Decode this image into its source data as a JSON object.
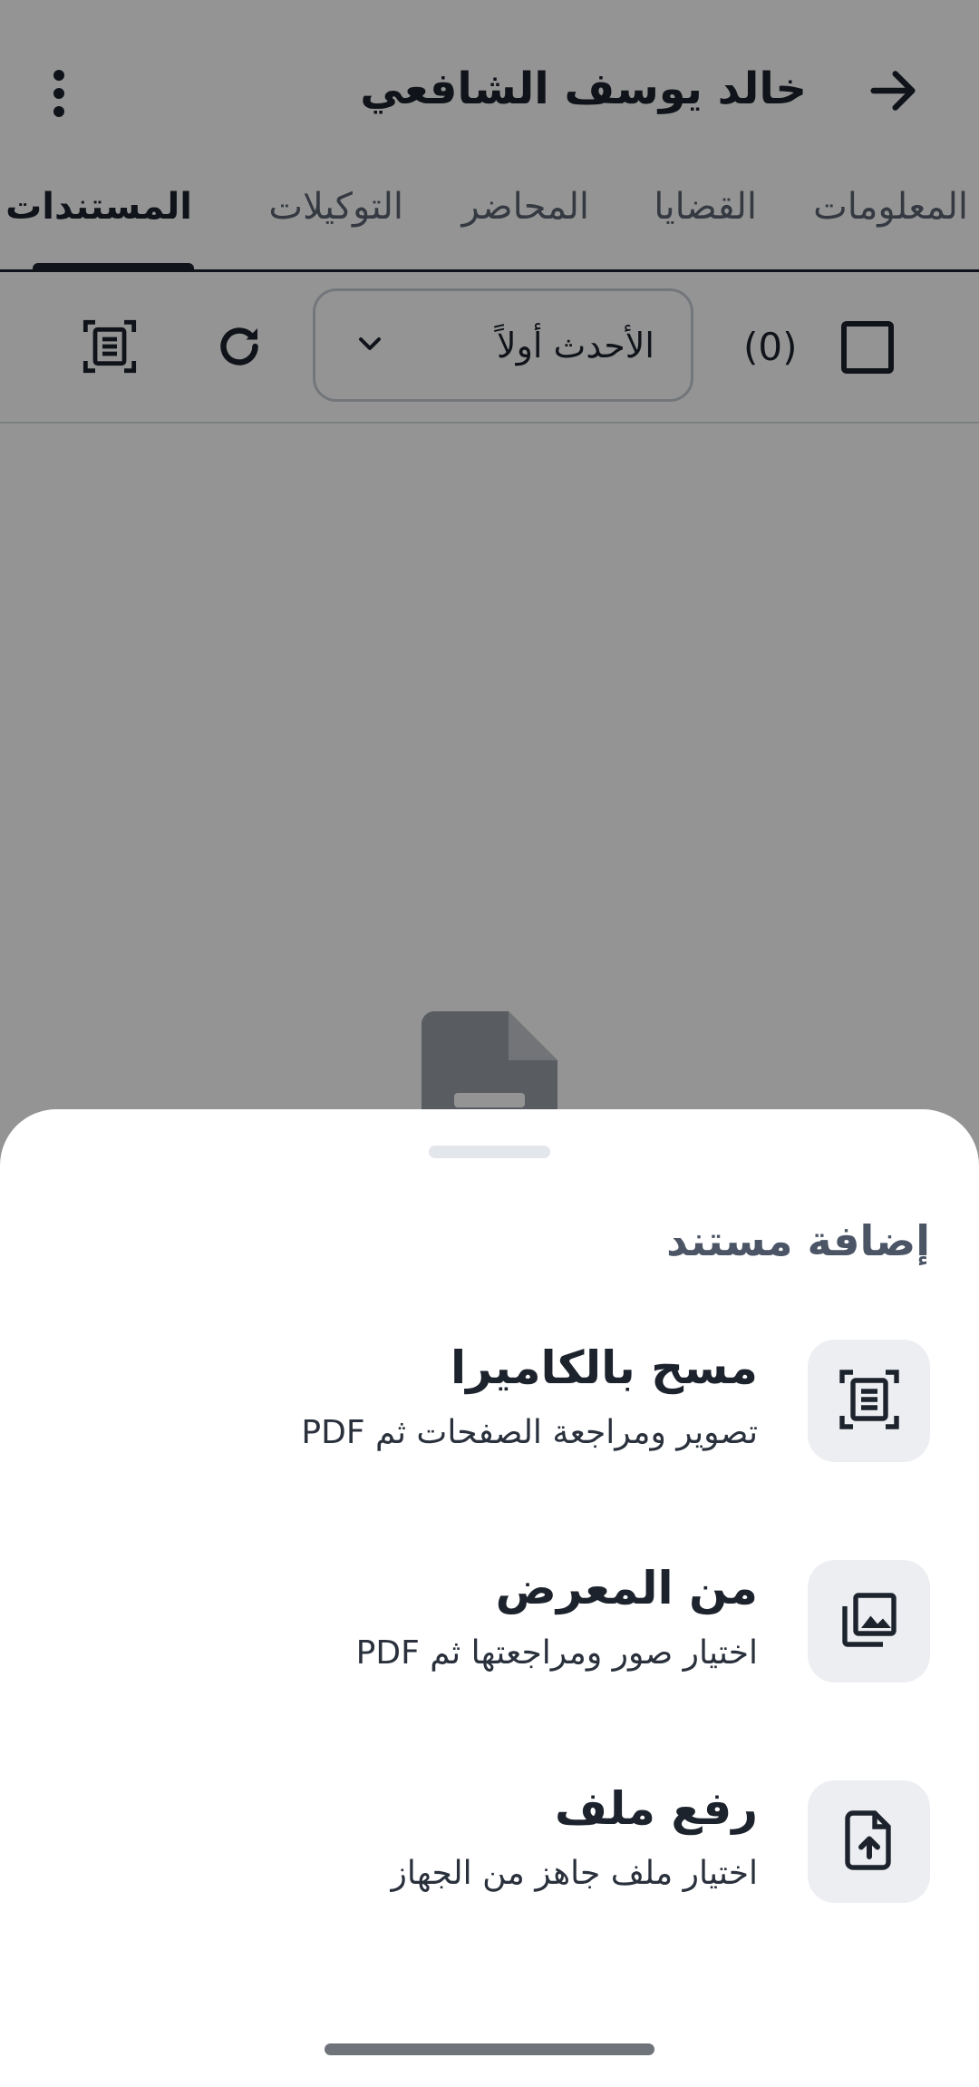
{
  "header": {
    "title": "خالد يوسف الشافعي",
    "back_icon": "arrow-right-icon",
    "more_icon": "more-vertical-icon"
  },
  "tabs": [
    {
      "label": "المعلومات",
      "active": false
    },
    {
      "label": "القضايا",
      "active": false
    },
    {
      "label": "المحاضر",
      "active": false
    },
    {
      "label": "التوكيلات",
      "active": false
    },
    {
      "label": "المستندات",
      "active": true
    }
  ],
  "toolbar": {
    "selected_count": "(0)",
    "sort_label": "الأحدث أولاً",
    "refresh_icon": "refresh-icon",
    "scan_icon": "document-scanner-icon"
  },
  "sheet": {
    "title": "إضافة مستند",
    "options": [
      {
        "title": "مسح بالكاميرا",
        "subtitle": "تصوير ومراجعة الصفحات ثم PDF",
        "icon": "document-scanner-icon"
      },
      {
        "title": "من المعرض",
        "subtitle": "اختيار صور ومراجعتها ثم PDF",
        "icon": "photo-library-icon"
      },
      {
        "title": "رفع ملف",
        "subtitle": "اختيار ملف جاهز من الجهاز",
        "icon": "file-upload-icon"
      }
    ]
  },
  "colors": {
    "primary_text": "#1d232d",
    "secondary_text": "#5c6572",
    "icon_tile": "#eceef1",
    "scrim": "rgba(0,0,0,0.42)"
  }
}
